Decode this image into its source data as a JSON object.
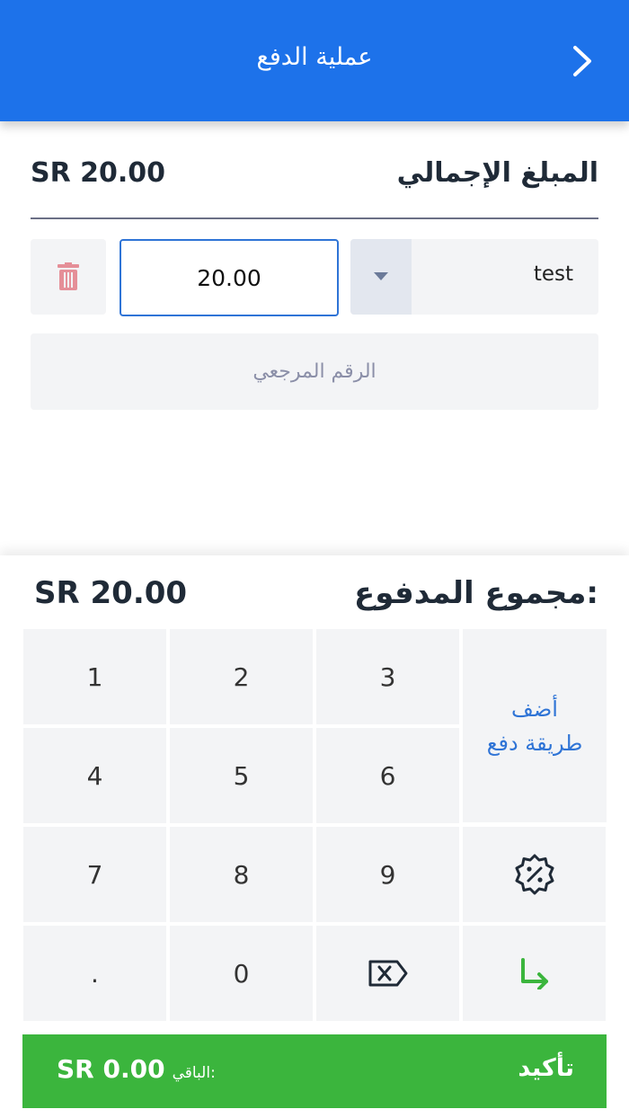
{
  "header": {
    "title": "عملية الدفع"
  },
  "summary": {
    "total_label": "المبلغ الإجمالي",
    "total_amount": "SR 20.00"
  },
  "payment_line": {
    "method": "test",
    "amount": "20.00",
    "reference_placeholder": "الرقم المرجعي"
  },
  "paid": {
    "label": "مجموع المدفوع:",
    "amount": "SR 20.00"
  },
  "keypad": {
    "keys": [
      "1",
      "2",
      "3",
      "4",
      "5",
      "6",
      "7",
      "8",
      "9",
      ".",
      "0"
    ],
    "add_method_label": "أضف طريقة دفع"
  },
  "footer": {
    "confirm_label": "تأكيد",
    "remaining_label": "الباقي:",
    "remaining_amount": "SR 0.00"
  },
  "colors": {
    "primary": "#1d72ea",
    "confirm": "#3bb53d",
    "delete": "#e58f98",
    "enter": "#3bb53d"
  }
}
